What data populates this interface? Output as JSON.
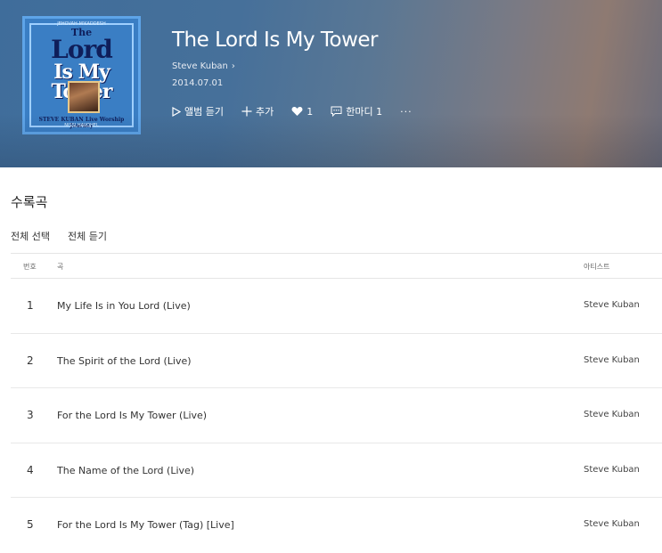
{
  "album": {
    "title": "The Lord Is My Tower",
    "artist": "Steve Kuban",
    "release_date": "2014.07.01",
    "cover": {
      "band_top": "· JEHOVAH-M'KADDESH ·",
      "title_line1": "The",
      "title_line2": "Lord",
      "title_line3": "Is My Tower",
      "subtitle": "STEVE KUBAN  Live Worship Journey",
      "band_bottom": "NISSI HAVOHEL"
    }
  },
  "actions": {
    "listen_album": "앨범 듣기",
    "add": "추가",
    "like_count": "1",
    "comment_label": "한마디",
    "comment_count": "1",
    "more": "···"
  },
  "tracklist": {
    "section_title": "수록곡",
    "select_all": "전체 선택",
    "play_all": "전체 듣기",
    "columns": {
      "number": "번호",
      "song": "곡",
      "artist": "아티스트"
    },
    "tracks": [
      {
        "number": "1",
        "title": "My Life Is in You Lord (Live)",
        "artist": "Steve Kuban"
      },
      {
        "number": "2",
        "title": "The Spirit of the Lord (Live)",
        "artist": "Steve Kuban"
      },
      {
        "number": "3",
        "title": "For the Lord Is My Tower (Live)",
        "artist": "Steve Kuban"
      },
      {
        "number": "4",
        "title": "The Name of the Lord (Live)",
        "artist": "Steve Kuban"
      },
      {
        "number": "5",
        "title": "For the Lord Is My Tower (Tag)  [Live]",
        "artist": "Steve Kuban"
      }
    ]
  },
  "colors": {
    "hero_start": "#3f6d9b",
    "hero_end": "#8e7a72",
    "text_primary": "#222222",
    "divider": "#e5e5e5"
  }
}
